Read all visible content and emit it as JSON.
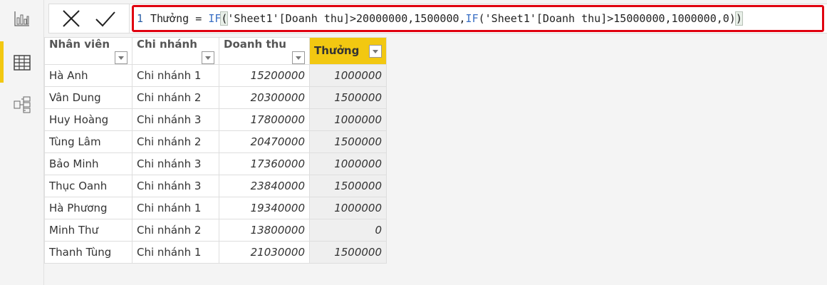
{
  "formula": {
    "line": "1",
    "prefix": "Thưởng = ",
    "if1": "IF",
    "open1": "(",
    "mid1": "'Sheet1'[Doanh thu]>20000000,1500000,",
    "if2": "IF",
    "mid2": "('Sheet1'[Doanh thu]>15000000,1000000,0)",
    "close": ")"
  },
  "table": {
    "columns": [
      "Nhân viên",
      "Chi nhánh",
      "Doanh thu",
      "Thưởng"
    ],
    "rows": [
      [
        "Hà Anh",
        "Chi nhánh 1",
        "15200000",
        "1000000"
      ],
      [
        "Vân Dung",
        "Chi nhánh 2",
        "20300000",
        "1500000"
      ],
      [
        "Huy Hoàng",
        "Chi nhánh 3",
        "17800000",
        "1000000"
      ],
      [
        "Tùng Lâm",
        "Chi nhánh 2",
        "20470000",
        "1500000"
      ],
      [
        "Bảo Minh",
        "Chi nhánh 3",
        "17360000",
        "1000000"
      ],
      [
        "Thục Oanh",
        "Chi nhánh 3",
        "23840000",
        "1500000"
      ],
      [
        "Hà Phương",
        "Chi nhánh 1",
        "19340000",
        "1000000"
      ],
      [
        "Minh Thư",
        "Chi nhánh 2",
        "13800000",
        "0"
      ],
      [
        "Thanh Tùng",
        "Chi nhánh 1",
        "21030000",
        "1500000"
      ]
    ]
  },
  "colors": {
    "accent": "#f2c811",
    "highlight": "#e0000f"
  }
}
